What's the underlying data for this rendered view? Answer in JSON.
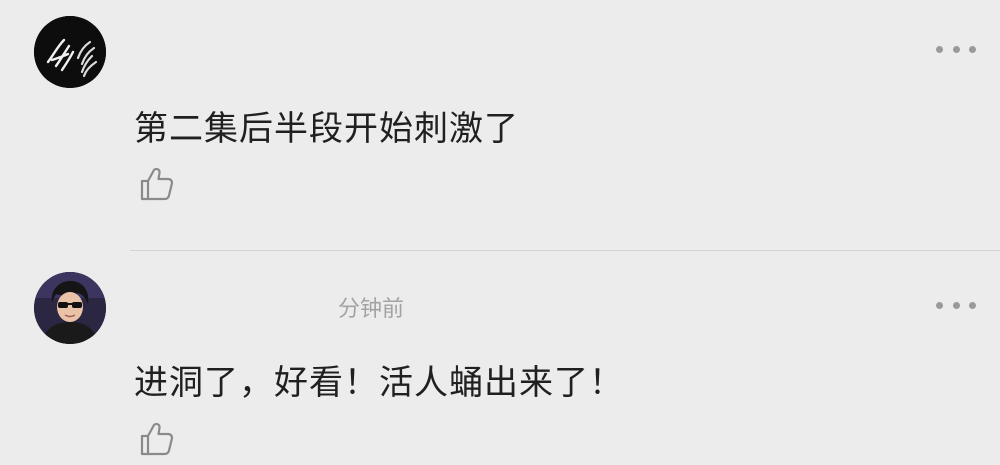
{
  "comments": [
    {
      "avatar_icon": "hands-avatar-icon",
      "username": "",
      "time": "",
      "text": "第二集后半段开始刺激了",
      "like_icon": "thumbs-up-icon",
      "more_icon": "more-horizontal-icon"
    },
    {
      "avatar_icon": "person-sunglasses-avatar-icon",
      "username": "",
      "time": "分钟前",
      "text": "进洞了，好看！活人蛹出来了！",
      "like_icon": "thumbs-up-icon",
      "more_icon": "more-horizontal-icon"
    }
  ],
  "colors": {
    "background": "#ececec",
    "text": "#202020",
    "meta": "#a3a3a3",
    "icon": "#8a8a8a",
    "divider": "#d4d4d4"
  }
}
